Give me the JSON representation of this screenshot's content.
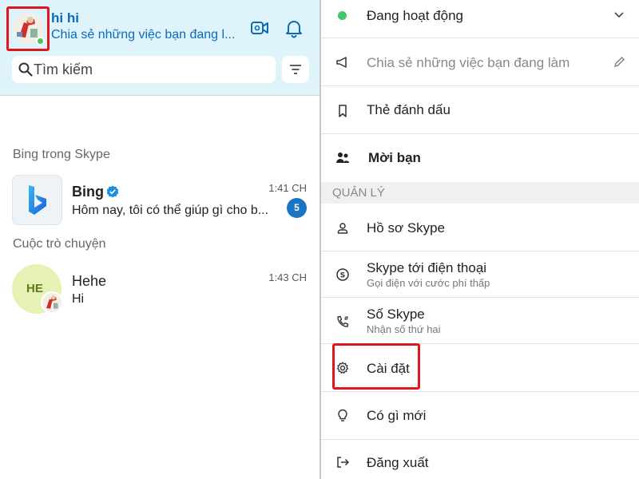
{
  "profile": {
    "name": "hi hi",
    "mood": "Chia sẻ những việc bạn đang l..."
  },
  "search": {
    "placeholder": "Tìm kiếm"
  },
  "sections": {
    "bing": "Bing trong Skype",
    "conversations": "Cuộc trò chuyện"
  },
  "chats": [
    {
      "name": "Bing",
      "preview": "Hôm nay, tôi có thể giúp gì cho b...",
      "time": "1:41 CH",
      "unread": "5"
    },
    {
      "name": "Hehe",
      "initials": "HE",
      "preview": "Hi",
      "time": "1:43 CH"
    }
  ],
  "menu": {
    "status": "Đang hoạt động",
    "mood_placeholder": "Chia sẻ những việc bạn đang làm",
    "bookmarks": "Thẻ đánh dấu",
    "invite": "Mời bạn",
    "manage_header": "QUẢN LÝ",
    "skype_profile": "Hồ sơ Skype",
    "skype_to_phone": "Skype tới điện thoại",
    "skype_to_phone_sub": "Gọi điện với cước phí thấp",
    "skype_number": "Số Skype",
    "skype_number_sub": "Nhận số thứ hai",
    "settings": "Cài đặt",
    "whats_new": "Có gì mới",
    "sign_out": "Đăng xuất"
  },
  "colors": {
    "header_bg": "#dff3fa",
    "accent_blue": "#0a6bb8",
    "online_green": "#44c766",
    "highlight_red": "#e0161f",
    "badge_blue": "#1a74c4"
  }
}
